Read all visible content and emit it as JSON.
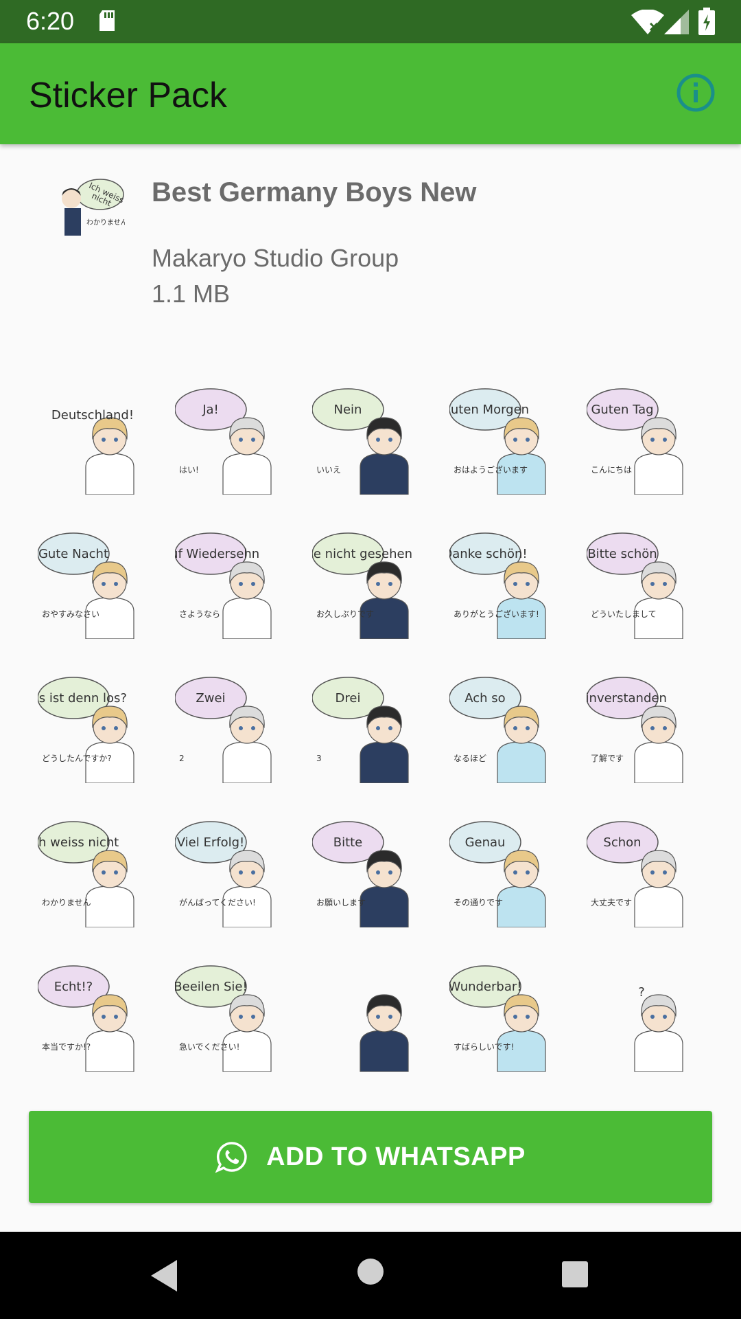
{
  "status_bar": {
    "time": "6:20",
    "icons": [
      "sd-card-icon",
      "wifi-icon",
      "signal-icon",
      "battery-icon"
    ]
  },
  "app_bar": {
    "title": "Sticker Pack",
    "info_icon": "info-icon",
    "background_color": "#4bbb36"
  },
  "pack": {
    "name": "Best Germany Boys New",
    "publisher": "Makaryo Studio Group",
    "size": "1.1 MB",
    "tray_sticker": {
      "text": "Ich weiss nicht",
      "sub": "わかりません"
    }
  },
  "stickers": [
    {
      "text": "Deutschland!",
      "sub": "",
      "bubble": ""
    },
    {
      "text": "Ja!",
      "sub": "はい!",
      "bubble": "#ecdcf0"
    },
    {
      "text": "Nein",
      "sub": "いいえ",
      "bubble": "#e4f0d8"
    },
    {
      "text": "Guten Morgen",
      "sub": "おはようございます",
      "bubble": "#dcecf0"
    },
    {
      "text": "Guten Tag",
      "sub": "こんにちは",
      "bubble": "#ecdcf0"
    },
    {
      "text": "Gute Nacht",
      "sub": "おやすみなさい",
      "bubble": "#dcecf0"
    },
    {
      "text": "Auf Wiedersehn",
      "sub": "さようなら",
      "bubble": "#ecdcf0"
    },
    {
      "text": "Lange nicht gesehen",
      "sub": "お久しぶりです",
      "bubble": "#e4f0d8"
    },
    {
      "text": "Danke schön!",
      "sub": "ありがとうございます!",
      "bubble": "#dcecf0"
    },
    {
      "text": "Bitte schön",
      "sub": "どういたしまして",
      "bubble": "#ecdcf0"
    },
    {
      "text": "Was ist denn los?",
      "sub": "どうしたんですか?",
      "bubble": "#e4f0d8"
    },
    {
      "text": "Zwei",
      "sub": "2",
      "bubble": "#ecdcf0"
    },
    {
      "text": "Drei",
      "sub": "3",
      "bubble": "#e4f0d8"
    },
    {
      "text": "Ach so",
      "sub": "なるほど",
      "bubble": "#dcecf0"
    },
    {
      "text": "Einverstanden",
      "sub": "了解です",
      "bubble": "#ecdcf0"
    },
    {
      "text": "Ich weiss nicht",
      "sub": "わかりません",
      "bubble": "#e4f0d8"
    },
    {
      "text": "Viel Erfolg!",
      "sub": "がんばってください!",
      "bubble": "#dcecf0"
    },
    {
      "text": "Bitte",
      "sub": "お願いします",
      "bubble": "#ecdcf0"
    },
    {
      "text": "Genau",
      "sub": "その通りです",
      "bubble": "#dcecf0"
    },
    {
      "text": "Schon",
      "sub": "大丈夫です",
      "bubble": "#ecdcf0"
    },
    {
      "text": "Echt!?",
      "sub": "本当ですか!?",
      "bubble": "#ecdcf0"
    },
    {
      "text": "Beeilen Sie!",
      "sub": "急いでください!",
      "bubble": "#e4f0d8"
    },
    {
      "text": "",
      "sub": "",
      "bubble": ""
    },
    {
      "text": "Wunderbar!",
      "sub": "すばらしいです!",
      "bubble": "#e4f0d8"
    },
    {
      "text": "?",
      "sub": "",
      "bubble": ""
    }
  ],
  "add_button": {
    "label": "ADD TO WHATSAPP",
    "icon": "whatsapp-icon"
  },
  "nav_bar": {
    "icons": [
      "back-icon",
      "home-icon",
      "recents-icon"
    ]
  }
}
